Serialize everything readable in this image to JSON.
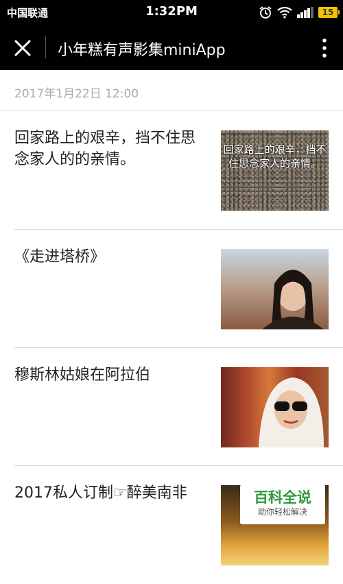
{
  "status_bar": {
    "carrier": "中国联通",
    "time": "1:32PM",
    "battery": "15",
    "icons": [
      "alarm-icon",
      "wifi-icon",
      "signal-icon",
      "battery-icon"
    ]
  },
  "nav": {
    "title": "小年糕有声影集miniApp",
    "icons": [
      "close-icon",
      "more-vertical-icon"
    ]
  },
  "date": "2017年1月22日 12:00",
  "articles": [
    {
      "title": "回家路上的艰辛，挡不住思念家人的的亲情。",
      "thumb_overlay": "回家路上的艰辛，挡不住思念家人的亲情。"
    },
    {
      "title": "《走进塔桥》"
    },
    {
      "title": "穆斯林姑娘在阿拉伯"
    },
    {
      "title": "2017私人订制☞醉美南非"
    }
  ],
  "watermark": {
    "main": "百科全说",
    "sub": "助你轻松解决"
  },
  "colors": {
    "bar_background": "#000000",
    "battery": "#f5c400",
    "date_text": "#aaaaaa",
    "watermark_green": "#2e9a3a"
  }
}
